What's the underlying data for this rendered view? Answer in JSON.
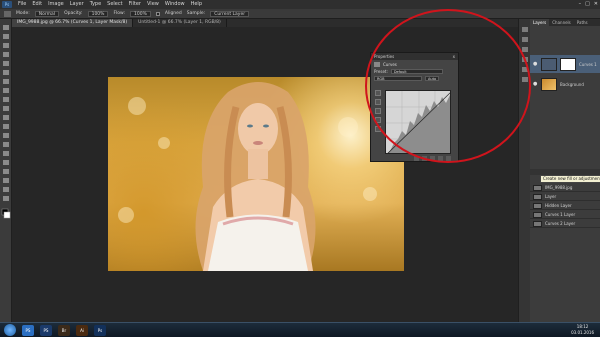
{
  "menubar": {
    "logo": "Ps",
    "items": [
      "File",
      "Edit",
      "Image",
      "Layer",
      "Type",
      "Select",
      "Filter",
      "View",
      "Window",
      "Help"
    ],
    "window_controls": [
      "–",
      "□",
      "✕"
    ]
  },
  "options": {
    "mode_label": "Mode:",
    "mode_value": "Normal",
    "opacity_label": "Opacity:",
    "opacity_value": "100%",
    "flow_label": "Flow:",
    "flow_value": "100%",
    "aligned_label": "Aligned",
    "sample_label": "Sample:",
    "sample_value": "Current Layer"
  },
  "tabs": [
    {
      "label": "IMG_9988.jpg @ 66.7% (Curves 1, Layer Mask/8)",
      "active": true
    },
    {
      "label": "Untitled-1 @ 66.7% (Layer 1, RGB/8)",
      "active": false
    }
  ],
  "curves": {
    "title": "Properties",
    "close": "x",
    "panel_name": "Curves",
    "preset_label": "Preset:",
    "preset_value": "Default",
    "channel_value": "RGB",
    "auto_label": "Auto"
  },
  "panel": {
    "top_tabs": [
      "Layers",
      "Channels",
      "Paths"
    ],
    "layer_top_name": "Curves 1",
    "layer_bg_name": "Background",
    "tooltip": "Create new fill or adjustment layer",
    "rows": [
      "IMG_9988.jpg",
      "Layer",
      "Hidden Layer",
      "Curves 1 Layer",
      "Curves 2 Layer"
    ]
  },
  "status": {
    "zoom": "66.67%",
    "doc": "Doc: 26.4M/26.4M"
  },
  "taskbar": {
    "apps": [
      "PS",
      "PS",
      "Br",
      "Ai",
      "Ps"
    ],
    "time": "18:12",
    "date": "03.01.2016"
  },
  "colors": {
    "annotation": "#d0141c",
    "accent": "#2a4f7a"
  }
}
